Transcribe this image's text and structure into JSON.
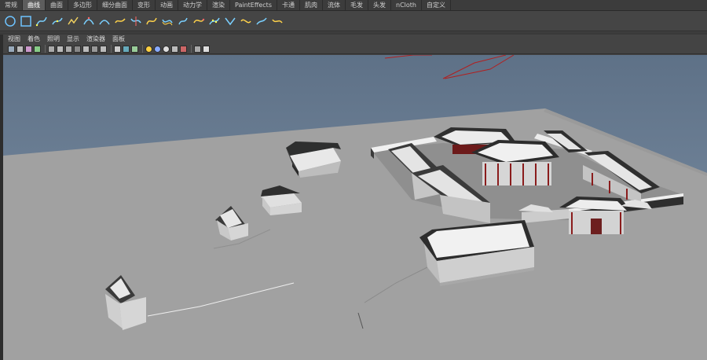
{
  "shelf_tabs": [
    {
      "label": "常规",
      "active": false
    },
    {
      "label": "曲线",
      "active": true
    },
    {
      "label": "曲面",
      "active": false
    },
    {
      "label": "多边形",
      "active": false
    },
    {
      "label": "细分曲面",
      "active": false
    },
    {
      "label": "变形",
      "active": false
    },
    {
      "label": "动画",
      "active": false
    },
    {
      "label": "动力学",
      "active": false
    },
    {
      "label": "渲染",
      "active": false
    },
    {
      "label": "PaintEffects",
      "active": false
    },
    {
      "label": "卡通",
      "active": false
    },
    {
      "label": "肌肉",
      "active": false
    },
    {
      "label": "流体",
      "active": false
    },
    {
      "label": "毛发",
      "active": false
    },
    {
      "label": "头发",
      "active": false
    },
    {
      "label": "nCloth",
      "active": false
    },
    {
      "label": "自定义",
      "active": false
    }
  ],
  "shelf_icons": [
    "nurbs-circle-icon",
    "nurbs-square-icon",
    "cv-curve-icon",
    "ep-curve-icon",
    "pencil-curve-icon",
    "arc-three-point-icon",
    "arc-two-point-icon",
    "attach-curves-icon",
    "detach-curves-icon",
    "rebuild-curve-icon",
    "offset-curve-icon",
    "reverse-curve-icon",
    "extend-curve-icon",
    "insert-knot-icon",
    "fillet-curve-icon",
    "cut-curve-icon",
    "smooth-curve-icon",
    "align-curves-icon"
  ],
  "panel_menu": [
    "视图",
    "着色",
    "照明",
    "显示",
    "渲染器",
    "面板"
  ],
  "panel_toolbar_icons": [
    "camera-icon",
    "camera-attributes-icon",
    "bookmark-icon",
    "image-plane-icon",
    "grid-icon",
    "film-gate-icon",
    "resolution-gate-icon",
    "gate-mask-icon",
    "field-chart-icon",
    "safe-action-icon",
    "safe-title-icon",
    "wireframe-icon",
    "smooth-shade-icon",
    "textured-icon",
    "use-all-lights-icon",
    "shadows-icon",
    "xray-icon",
    "isolate-icon",
    "hud-icon",
    "hardware-render-icon",
    "default-lights-icon"
  ],
  "colors": {
    "sky_top": "#5e7187",
    "sky_bottom": "#8194a9",
    "ground": "#a1a1a1",
    "roof": "#2e2f2f",
    "roof_light": "#eaeaea",
    "wall": "#d8d8d8",
    "column_red": "#8a1c1c",
    "camera_line": "#b02020"
  }
}
